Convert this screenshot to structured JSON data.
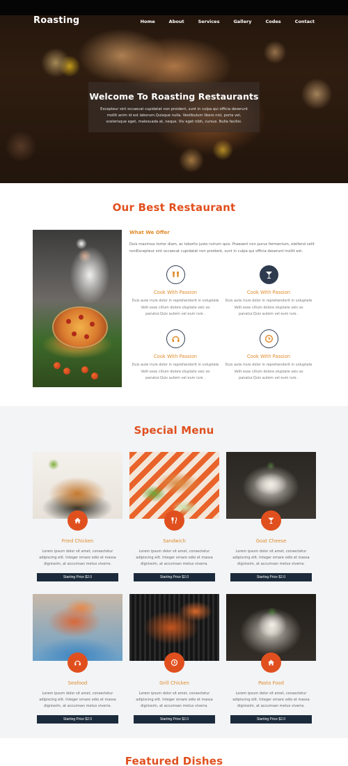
{
  "header": {
    "logo": "Roasting",
    "nav": [
      "Home",
      "About",
      "Services",
      "Gallery",
      "Codes",
      "Contact"
    ]
  },
  "hero": {
    "title": "Welcome To Roasting Restaurants",
    "text": "Excepteur sint occaecat cupidatat non proident, sunt in culpa qui officia deserunt mollit anim id est laborum.Quisque nulla. Vestibulum libero nisl, porta vel, scelerisque eget, malesuada at, neque. Viv eget nibh, cursus. Nulla facilisi."
  },
  "about": {
    "section_title": "Our Best Restaurant",
    "offer_title": "What We Offer",
    "offer_text": "Duis maximus tortor diam, ac lobortis justo rutrum quis. Praesent non purus fermentum, eleifend velit nonExcepteur sint occaecat cupidatat non proident, sunt in culpa qui officia deserunt mollit est.",
    "features": [
      {
        "icon": "drinks-icon",
        "title": "Cook With Passion",
        "text": "Duis aute irure dolor in reprehenderit in voluptate Velit esse cillum dolore oluptate veic es panatur.Quis autem vel eum iure ."
      },
      {
        "icon": "cocktail-icon",
        "title": "Cook With Passion",
        "text": "Duis aute irure dolor in reprehenderit in voluptate Velit esse cillum dolore oluptate veic es panatur.Quis autem vel eum iure ."
      },
      {
        "icon": "headphones-icon",
        "title": "Cook With Passion",
        "text": "Duis aute irure dolor in reprehenderit in voluptate Velit esse cillum dolore oluptate veic es panatur.Quis autem vel eum iure ."
      },
      {
        "icon": "clock-icon",
        "title": "Cook With Passion",
        "text": "Duis aute irure dolor in reprehenderit in voluptate Velit esse cillum dolore oluptate veic es panatur.Quis autem vel eum iure ."
      }
    ]
  },
  "menu": {
    "section_title": "Special Menu",
    "items": [
      {
        "title": "Fried Chicken",
        "icon": "home-icon",
        "text": "Lorem ipsum dolor sit amet, consectetur adipiscing elit. Integer ornare odio et massa dignissim, at accumsan metus viverra.",
        "button": "Starting Price $2.0"
      },
      {
        "title": "Sandwich",
        "icon": "cutlery-icon",
        "text": "Lorem ipsum dolor sit amet, consectetur adipiscing elit. Integer ornare odio et massa dignissim, at accumsan metus viverra.",
        "button": "Starting Price $2.0"
      },
      {
        "title": "Goat Cheese",
        "icon": "cocktail-icon",
        "text": "Lorem ipsum dolor sit amet, consectetur adipiscing elit. Integer ornare odio et massa dignissim, at accumsan metus viverra.",
        "button": "Starting Price $2.0"
      },
      {
        "title": "Seafood",
        "icon": "headphones-icon",
        "text": "Lorem ipsum dolor sit amet, consectetur adipiscing elit. Integer ornare odio et massa dignissim, at accumsan metus viverra.",
        "button": "Starting Price $2.0"
      },
      {
        "title": "Grill Chicken",
        "icon": "clock-icon",
        "text": "Lorem ipsum dolor sit amet, consectetur adipiscing elit. Integer ornare odio et massa dignissim, at accumsan metus viverra.",
        "button": "Starting Price $2.0"
      },
      {
        "title": "Pasta Food",
        "icon": "home-icon",
        "text": "Lorem ipsum dolor sit amet, consectetur adipiscing elit. Integer ornare odio et massa dignissim, at accumsan metus viverra.",
        "button": "Starting Price $2.0"
      }
    ]
  },
  "featured": {
    "section_title": "Featured Dishes"
  },
  "colors": {
    "accent": "#e0501f",
    "accent_light": "#e08a2a",
    "navy": "#1c2b3c",
    "navy_icon": "#2e3a4e"
  }
}
